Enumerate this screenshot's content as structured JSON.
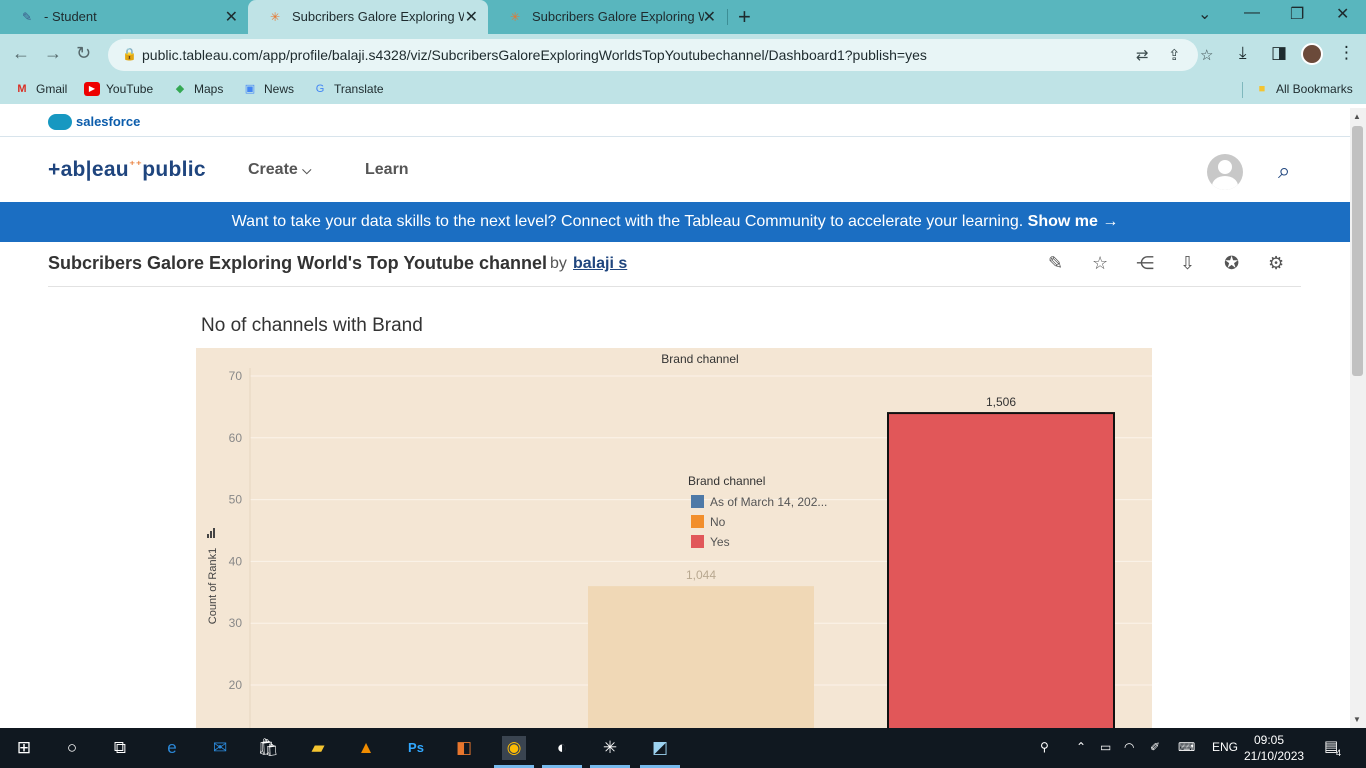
{
  "browser": {
    "tabs": [
      {
        "title": "- Student",
        "active": false,
        "icon": "classroom-icon"
      },
      {
        "title": "Subcribers Galore Exploring Wor",
        "active": true,
        "icon": "tableau-icon"
      },
      {
        "title": "Subcribers Galore Exploring Wor",
        "active": false,
        "icon": "tableau-icon"
      }
    ],
    "url": "public.tableau.com/app/profile/balaji.s4328/viz/SubcribersGaloreExploringWorldsTopYoutubechannel/Dashboard1?publish=yes",
    "bookmarks": [
      {
        "label": "Gmail",
        "icon": "gmail-icon"
      },
      {
        "label": "YouTube",
        "icon": "youtube-icon"
      },
      {
        "label": "Maps",
        "icon": "maps-icon"
      },
      {
        "label": "News",
        "icon": "news-icon"
      },
      {
        "label": "Translate",
        "icon": "translate-icon"
      }
    ],
    "all_bookmarks": "All Bookmarks"
  },
  "site": {
    "salesforce": "salesforce",
    "logo": "+ab|eau",
    "logo_suffix": "public",
    "nav": [
      "Create",
      "Learn"
    ],
    "banner_text": "Want to take your data skills to the next level? Connect with the Tableau Community to accelerate your learning.",
    "banner_link": "Show me →"
  },
  "viz": {
    "title": "Subcribers Galore Exploring World's Top Youtube channel",
    "by": "by",
    "author": "balaji s"
  },
  "chart_data": {
    "type": "bar",
    "title": "No of channels with Brand",
    "header": "Brand channel",
    "ylabel": "Count of Rank1",
    "ylim": [
      15,
      70
    ],
    "yticks": [
      20,
      30,
      40,
      50,
      60,
      70
    ],
    "categories": [
      "As of March 14, 202...",
      "No",
      "Yes"
    ],
    "series": [
      {
        "name": "As of March 14, 202...",
        "color": "#4e79a7",
        "values": [
          null,
          null,
          null
        ]
      },
      {
        "name": "No",
        "color": "#f28e2b",
        "values": [
          null,
          36,
          null
        ]
      },
      {
        "name": "Yes",
        "color": "#e15759",
        "values": [
          null,
          null,
          64
        ]
      }
    ],
    "data_labels": [
      null,
      "1,044",
      "1,506"
    ],
    "legend": {
      "title": "Brand channel",
      "placement": "center",
      "items": [
        {
          "label": "As of March 14, 202...",
          "color": "#4e79a7"
        },
        {
          "label": "No",
          "color": "#f28e2b"
        },
        {
          "label": "Yes",
          "color": "#e15759"
        }
      ]
    }
  },
  "taskbar": {
    "language": "ENG",
    "time": "09:05",
    "date": "21/10/2023",
    "notifications": "4"
  }
}
